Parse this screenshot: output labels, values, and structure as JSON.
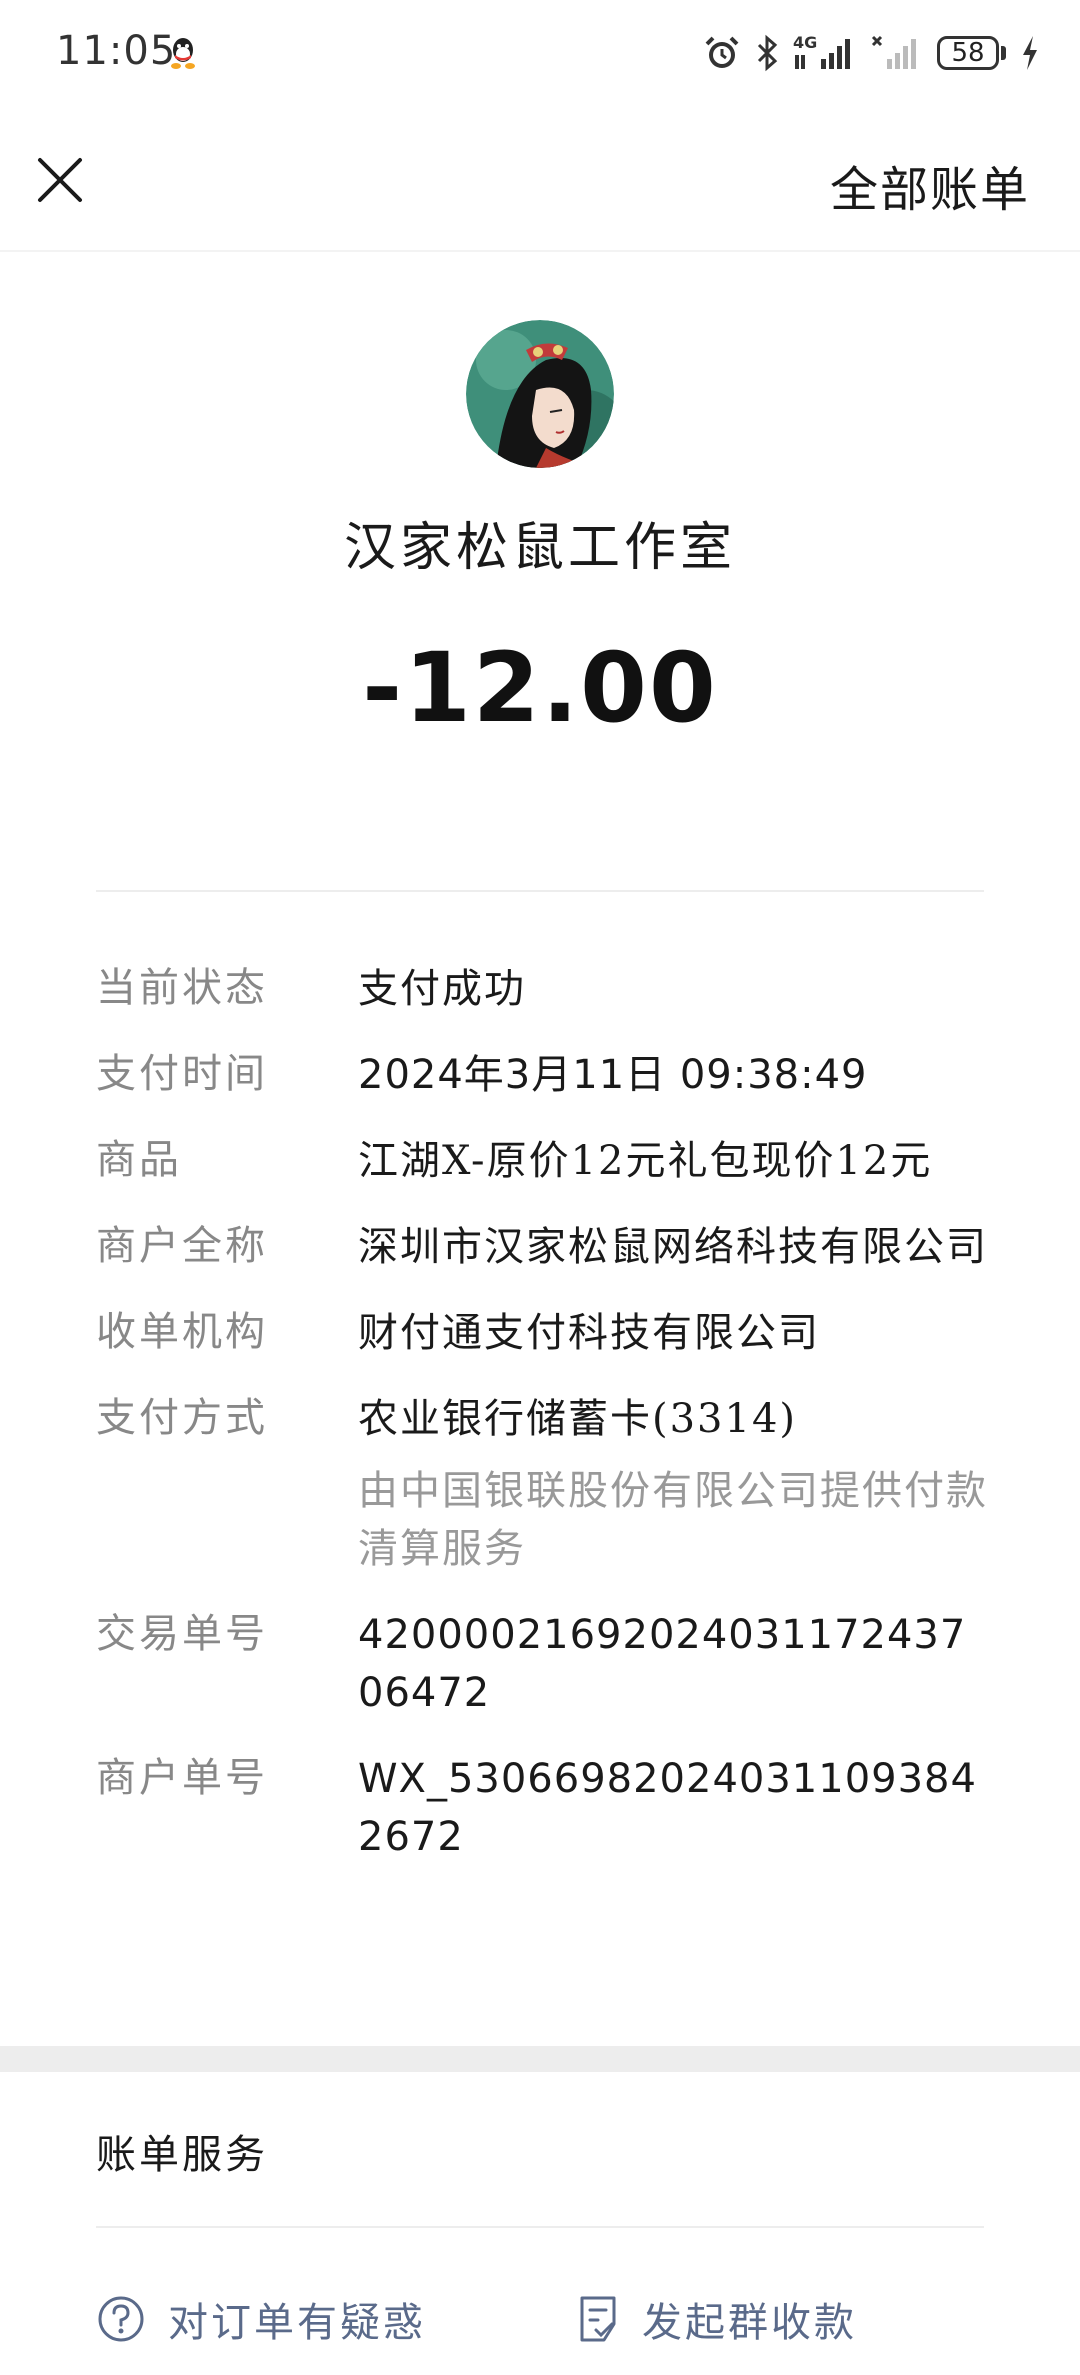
{
  "status_bar": {
    "time": "11:05",
    "network_label": "4G",
    "battery": "58",
    "icons": [
      "qq-icon",
      "alarm-icon",
      "bluetooth-icon",
      "signal-icon",
      "no-signal-icon",
      "battery-icon",
      "charging-icon"
    ]
  },
  "nav": {
    "close_icon": "close-icon",
    "all_bills": "全部账单"
  },
  "merchant": {
    "name": "汉家松鼠工作室",
    "amount": "-12.00"
  },
  "details": [
    {
      "label": "当前状态",
      "value": "支付成功"
    },
    {
      "label": "支付时间",
      "value": "2024年3月11日 09:38:49"
    },
    {
      "label": "商品",
      "value": "江湖X-原价12元礼包现价12元"
    },
    {
      "label": "商户全称",
      "value": "深圳市汉家松鼠网络科技有限公司"
    },
    {
      "label": "收单机构",
      "value": "财付通支付科技有限公司"
    },
    {
      "label": "支付方式",
      "value": "农业银行储蓄卡(3314)",
      "note": "由中国银联股份有限公司提供付款清算服务"
    },
    {
      "label": "交易单号",
      "value": "42000021692024031172437064​72"
    },
    {
      "label": "商户单号",
      "value": "WX_53066982024031109384267​2"
    }
  ],
  "services": {
    "title": "账单服务",
    "items": [
      {
        "label": "对订单有疑惑",
        "icon": "question-circle-icon"
      },
      {
        "label": "发起群收款",
        "icon": "checklist-icon"
      }
    ]
  },
  "colors": {
    "label_gray": "#888888",
    "link_blue": "#5a6a8a",
    "band_gray": "#ededed"
  }
}
